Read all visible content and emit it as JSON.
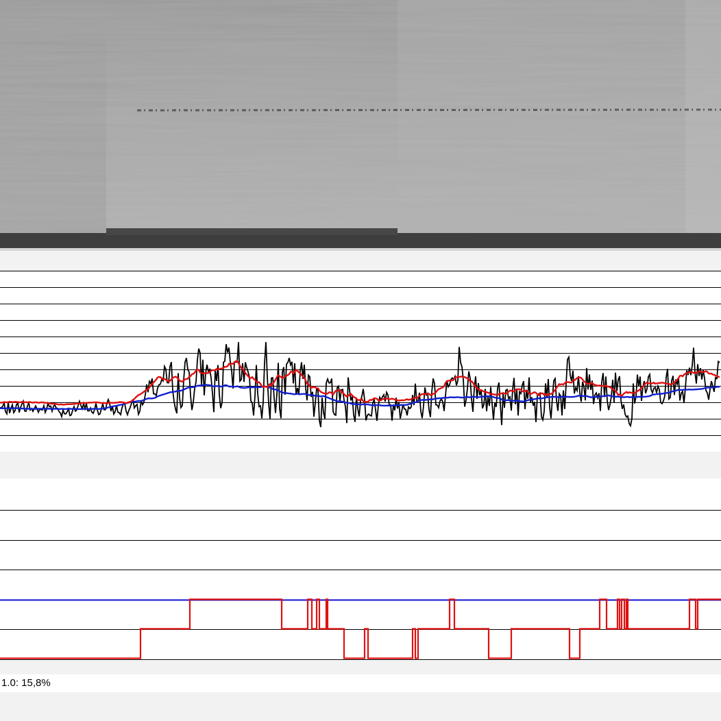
{
  "surface_image": {
    "description_icon": "texture-image-icon"
  },
  "status": {
    "text": "1.0: 15,8%"
  },
  "colors": {
    "signal": "#000000",
    "mean_red": "#e01010",
    "mean_blue": "#1020d0",
    "grid": "#000000",
    "class_blue": "#1010d0",
    "class_red": "#e01010"
  },
  "chart_data": [
    {
      "type": "line",
      "name": "signal-chart",
      "ylim": [
        0,
        10
      ],
      "grid_levels": [
        0,
        1,
        2,
        3,
        4,
        5,
        6,
        7,
        8,
        9,
        10
      ],
      "x_count": 1052,
      "series": [
        {
          "id": "raw",
          "style": "black",
          "seed": 7
        },
        {
          "id": "red-mean",
          "style": "red"
        },
        {
          "id": "blue-mean",
          "style": "blue"
        }
      ],
      "envelope": [
        {
          "x": 0,
          "mean": 1.6,
          "amp": 0.7
        },
        {
          "x": 205,
          "mean": 1.6,
          "amp": 0.8
        },
        {
          "x": 215,
          "mean": 3.0,
          "amp": 1.3
        },
        {
          "x": 290,
          "mean": 3.4,
          "amp": 2.8
        },
        {
          "x": 340,
          "mean": 3.4,
          "amp": 3.3
        },
        {
          "x": 385,
          "mean": 3.2,
          "amp": 3.5
        },
        {
          "x": 440,
          "mean": 2.8,
          "amp": 2.8
        },
        {
          "x": 500,
          "mean": 2.2,
          "amp": 2.5
        },
        {
          "x": 560,
          "mean": 1.6,
          "amp": 1.6
        },
        {
          "x": 660,
          "mean": 3.2,
          "amp": 2.5
        },
        {
          "x": 720,
          "mean": 2.0,
          "amp": 2.3
        },
        {
          "x": 810,
          "mean": 2.8,
          "amp": 3.0
        },
        {
          "x": 875,
          "mean": 3.2,
          "amp": 2.8
        },
        {
          "x": 960,
          "mean": 2.2,
          "amp": 2.0
        },
        {
          "x": 1052,
          "mean": 3.8,
          "amp": 2.2
        }
      ]
    },
    {
      "type": "line",
      "name": "classification-chart",
      "ylim": [
        0,
        5
      ],
      "grid_levels": [
        0,
        1,
        2,
        3,
        4,
        5
      ],
      "x_count": 1052,
      "series": [
        {
          "id": "blue-level",
          "style": "blue",
          "level": 2
        },
        {
          "id": "red-level",
          "style": "red",
          "steps": [
            {
              "x": 0,
              "y": 0
            },
            {
              "x": 205,
              "y": 1
            },
            {
              "x": 277,
              "y": 2
            },
            {
              "x": 411,
              "y": 1
            },
            {
              "x": 449,
              "y": 2
            },
            {
              "x": 455,
              "y": 1
            },
            {
              "x": 462,
              "y": 2
            },
            {
              "x": 466,
              "y": 1
            },
            {
              "x": 476,
              "y": 2
            },
            {
              "x": 478,
              "y": 1
            },
            {
              "x": 502,
              "y": 0
            },
            {
              "x": 532,
              "y": 1
            },
            {
              "x": 537,
              "y": 0
            },
            {
              "x": 602,
              "y": 1
            },
            {
              "x": 606,
              "y": 0
            },
            {
              "x": 610,
              "y": 1
            },
            {
              "x": 656,
              "y": 2
            },
            {
              "x": 663,
              "y": 1
            },
            {
              "x": 713,
              "y": 0
            },
            {
              "x": 746,
              "y": 1
            },
            {
              "x": 831,
              "y": 0
            },
            {
              "x": 846,
              "y": 1
            },
            {
              "x": 875,
              "y": 2
            },
            {
              "x": 885,
              "y": 1
            },
            {
              "x": 901,
              "y": 2
            },
            {
              "x": 904,
              "y": 1
            },
            {
              "x": 907,
              "y": 2
            },
            {
              "x": 911,
              "y": 1
            },
            {
              "x": 914,
              "y": 2
            },
            {
              "x": 916,
              "y": 1
            },
            {
              "x": 1006,
              "y": 2
            },
            {
              "x": 1015,
              "y": 1
            },
            {
              "x": 1018,
              "y": 2
            },
            {
              "x": 1052,
              "y": 2
            }
          ]
        }
      ]
    }
  ]
}
